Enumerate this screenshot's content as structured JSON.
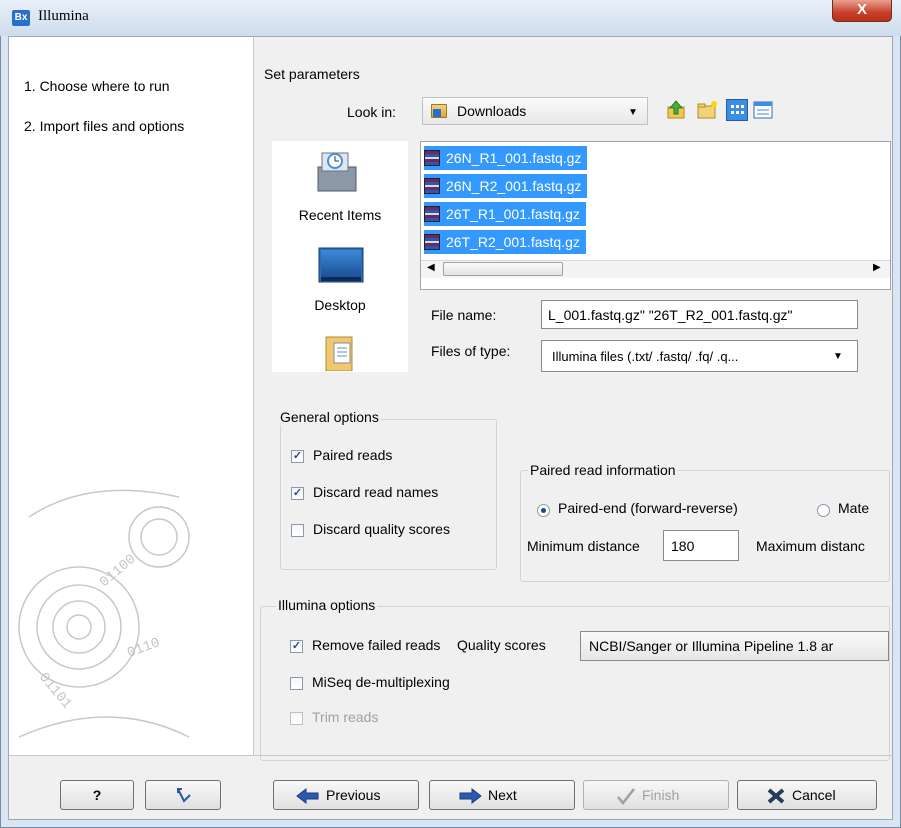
{
  "window": {
    "title": "Illumina",
    "app_icon": "Bx",
    "close_symbol": "X"
  },
  "steps": [
    {
      "label": "1.  Choose where to run"
    },
    {
      "label": "2.  Import files and options"
    }
  ],
  "set_parameters": {
    "title": "Set parameters"
  },
  "look_in": {
    "label": "Look in:",
    "value": "Downloads",
    "icons": [
      "up-folder-icon",
      "new-folder-icon",
      "list-view-icon",
      "details-view-icon"
    ]
  },
  "places": [
    {
      "label": "Recent Items",
      "icon": "recent-items-icon"
    },
    {
      "label": "Desktop",
      "icon": "desktop-icon"
    },
    {
      "label": "",
      "icon": "documents-icon"
    }
  ],
  "files": [
    {
      "name": "26N_R1_001.fastq.gz"
    },
    {
      "name": "26N_R2_001.fastq.gz"
    },
    {
      "name": "26T_R1_001.fastq.gz"
    },
    {
      "name": "26T_R2_001.fastq.gz"
    }
  ],
  "file_name": {
    "label": "File name:",
    "value": "L_001.fastq.gz\" \"26T_R2_001.fastq.gz\""
  },
  "files_of_type": {
    "label": "Files of type:",
    "value": "Illumina files (.txt/ .fastq/ .fq/ .q..."
  },
  "general_options": {
    "title": "General options",
    "paired_reads": {
      "label": "Paired reads",
      "checked": true
    },
    "discard_read_names": {
      "label": "Discard read names",
      "checked": true
    },
    "discard_quality_scores": {
      "label": "Discard quality scores",
      "checked": false
    }
  },
  "paired_read_info": {
    "title": "Paired read information",
    "paired_end": {
      "label": "Paired-end (forward-reverse)",
      "selected": true
    },
    "mate": {
      "label": "Mate",
      "selected": false
    },
    "min_distance": {
      "label": "Minimum distance",
      "value": "180"
    },
    "max_distance": {
      "label": "Maximum distanc"
    }
  },
  "illumina_options": {
    "title": "Illumina options",
    "remove_failed": {
      "label": "Remove failed reads",
      "checked": true
    },
    "quality_scores": {
      "label": "Quality scores",
      "value": "NCBI/Sanger or Illumina Pipeline 1.8 ar"
    },
    "miseq": {
      "label": "MiSeq de-multiplexing",
      "checked": false
    },
    "trim_reads": {
      "label": "Trim reads",
      "checked": false,
      "enabled": false
    }
  },
  "buttons": {
    "help": "?",
    "previous": "Previous",
    "next": "Next",
    "finish": "Finish",
    "cancel": "Cancel"
  },
  "colors": {
    "selection": "#3399ff",
    "window_bg": "#f0f0f0"
  }
}
